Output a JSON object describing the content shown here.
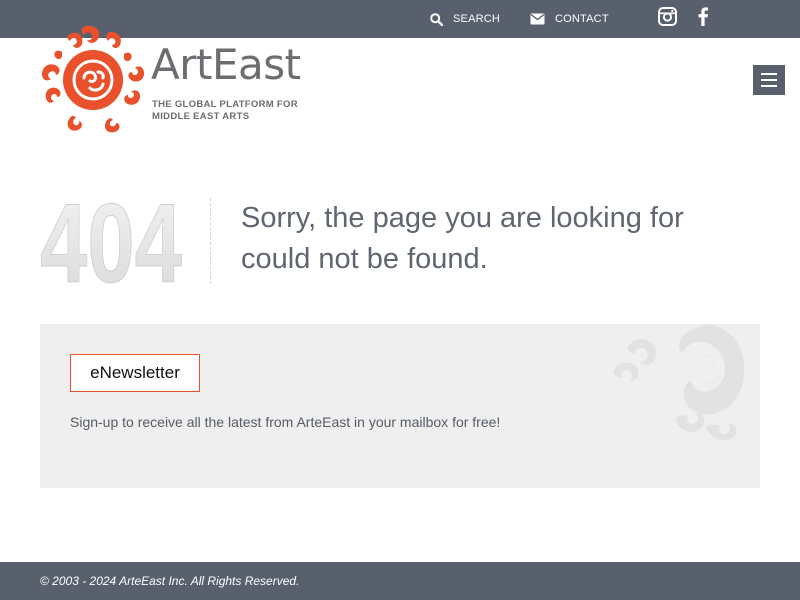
{
  "topbar": {
    "search_label": "SEARCH",
    "contact_label": "CONTACT",
    "social": [
      "instagram-icon",
      "facebook-icon"
    ]
  },
  "logo": {
    "name": "ArtEast",
    "tagline_line1": "THE GLOBAL PLATFORM FOR",
    "tagline_line2": "MIDDLE EAST ARTS",
    "brand_color": "#e8512b"
  },
  "error": {
    "code": "404",
    "message": "Sorry, the page you are looking for could not be found."
  },
  "newsletter": {
    "button_label": "eNewsletter",
    "description": "Sign-up to receive all the latest from ArteEast in your mailbox for free!"
  },
  "footer": {
    "copyright": "© 2003 - 2024 ArteEast Inc. All Rights Reserved."
  },
  "colors": {
    "bar": "#58606d",
    "accent": "#e8512b",
    "panel": "#efefef"
  }
}
